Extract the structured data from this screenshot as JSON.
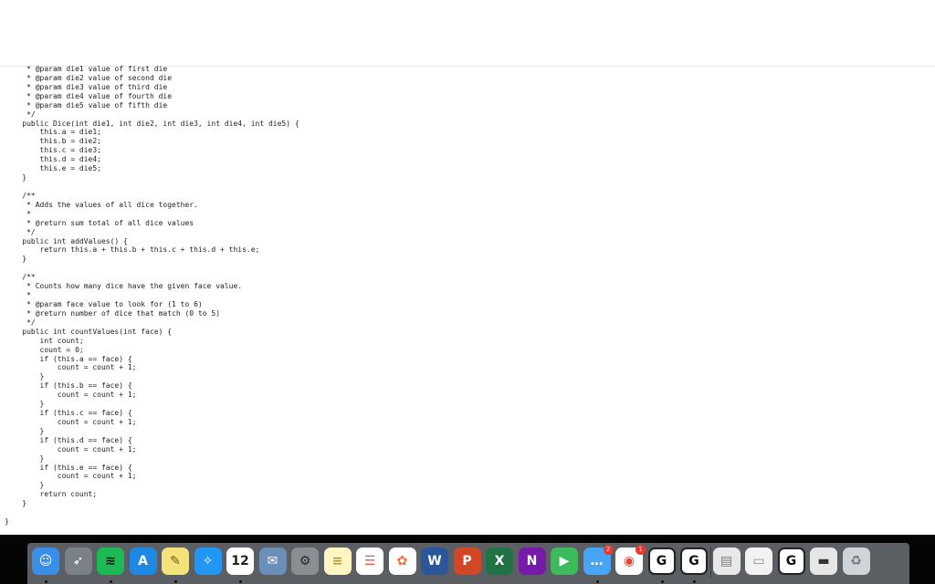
{
  "editor": {
    "code_lines": [
      "     * @param die1 value of first die",
      "     * @param die2 value of second die",
      "     * @param die3 value of third die",
      "     * @param die4 value of fourth die",
      "     * @param die5 value of fifth die",
      "     */",
      "    public Dice(int die1, int die2, int die3, int die4, int die5) {",
      "        this.a = die1;",
      "        this.b = die2;",
      "        this.c = die3;",
      "        this.d = die4;",
      "        this.e = die5;",
      "    }",
      "",
      "    /**",
      "     * Adds the values of all dice together.",
      "     *",
      "     * @return sum total of all dice values",
      "     */",
      "    public int addValues() {",
      "        return this.a + this.b + this.c + this.d + this.e;",
      "    }",
      "",
      "    /**",
      "     * Counts how many dice have the given face value.",
      "     *",
      "     * @param face value to look for (1 to 6)",
      "     * @return number of dice that match (0 to 5)",
      "     */",
      "    public int countValues(int face) {",
      "        int count;",
      "        count = 0;",
      "        if (this.a == face) {",
      "            count = count + 1;",
      "        }",
      "        if (this.b == face) {",
      "            count = count + 1;",
      "        }",
      "        if (this.c == face) {",
      "            count = count + 1;",
      "        }",
      "        if (this.d == face) {",
      "            count = count + 1;",
      "        }",
      "        if (this.e == face) {",
      "            count = count + 1;",
      "        }",
      "        return count;",
      "    }",
      "",
      "}"
    ]
  },
  "dock": {
    "apps": [
      {
        "name": "finder-icon",
        "glyph": "☺",
        "bg": "#3a8ee6",
        "fg": "#ffffff",
        "running": true
      },
      {
        "name": "launchpad-icon",
        "glyph": "➶",
        "bg": "#7b8188",
        "fg": "#ffffff",
        "running": false
      },
      {
        "name": "spotify-icon",
        "glyph": "≋",
        "bg": "#1db954",
        "fg": "#111111",
        "running": true
      },
      {
        "name": "app-store-icon",
        "glyph": "A",
        "bg": "#1e88e5",
        "fg": "#ffffff",
        "running": false
      },
      {
        "name": "stickies-icon",
        "glyph": "✎",
        "bg": "#f4e27a",
        "fg": "#6b5d1a",
        "running": true
      },
      {
        "name": "safari-icon",
        "glyph": "✧",
        "bg": "#2196f3",
        "fg": "#ffffff",
        "running": false
      },
      {
        "name": "calendar-icon",
        "glyph": "12",
        "bg": "#ffffff",
        "fg": "#222222",
        "running": true
      },
      {
        "name": "preview-icon",
        "glyph": "✉",
        "bg": "#6c8fb8",
        "fg": "#ffffff",
        "running": false
      },
      {
        "name": "system-preferences-icon",
        "glyph": "⚙",
        "bg": "#8a8d91",
        "fg": "#2a2a2a",
        "running": false
      },
      {
        "name": "notes-icon",
        "glyph": "≡",
        "bg": "#fff6c2",
        "fg": "#b09a3a",
        "running": false
      },
      {
        "name": "reminders-icon",
        "glyph": "☰",
        "bg": "#ffffff",
        "fg": "#e55d4b",
        "running": false
      },
      {
        "name": "photos-icon",
        "glyph": "✿",
        "bg": "#ffffff",
        "fg": "#ef6c3a",
        "running": false
      },
      {
        "name": "word-icon",
        "glyph": "W",
        "bg": "#2b579a",
        "fg": "#ffffff",
        "running": false
      },
      {
        "name": "powerpoint-icon",
        "glyph": "P",
        "bg": "#d24726",
        "fg": "#ffffff",
        "running": false
      },
      {
        "name": "excel-icon",
        "glyph": "X",
        "bg": "#217346",
        "fg": "#ffffff",
        "running": false
      },
      {
        "name": "onenote-icon",
        "glyph": "N",
        "bg": "#7719aa",
        "fg": "#ffffff",
        "running": false
      },
      {
        "name": "facetime-icon",
        "glyph": "▶",
        "bg": "#3dbb5a",
        "fg": "#ffffff",
        "running": false
      },
      {
        "name": "messages-icon",
        "glyph": "…",
        "bg": "#47a5f5",
        "fg": "#ffffff",
        "running": true,
        "badge": "2"
      },
      {
        "name": "chrome-icon",
        "glyph": "◉",
        "bg": "#ffffff",
        "fg": "#db4437",
        "running": false,
        "badge": "1"
      },
      {
        "name": "grammarly-icon",
        "glyph": "G",
        "bg": "#ffffff",
        "fg": "#111111",
        "running": true
      },
      {
        "name": "grammarly-2-icon",
        "glyph": "G",
        "bg": "#ffffff",
        "fg": "#111111",
        "running": true
      },
      {
        "name": "document-icon",
        "glyph": "▤",
        "bg": "#e8e8e8",
        "fg": "#777777",
        "running": false
      },
      {
        "name": "chrome-app-icon",
        "glyph": "▭",
        "bg": "#f2f2f2",
        "fg": "#888888",
        "running": false
      },
      {
        "name": "grammarly-3-icon",
        "glyph": "G",
        "bg": "#ffffff",
        "fg": "#111111",
        "running": false
      },
      {
        "name": "printer-icon",
        "glyph": "▬",
        "bg": "#e6e6e6",
        "fg": "#333333",
        "running": false
      },
      {
        "name": "trash-icon",
        "glyph": "♻",
        "bg": "#cfd4d8",
        "fg": "#6d7378",
        "running": false
      }
    ]
  }
}
